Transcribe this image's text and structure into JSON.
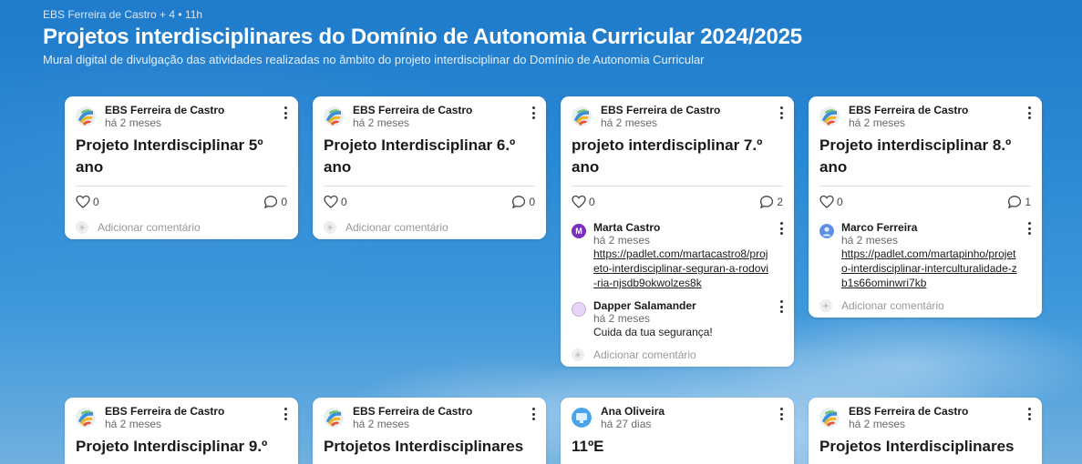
{
  "header": {
    "meta": "EBS Ferreira de Castro + 4 • 11h",
    "title": "Projetos interdisciplinares do Domínio de Autonomia Curricular 2024/2025",
    "subtitle": "Mural digital de divulgação das atividades realizadas no âmbito do projeto interdisciplinar do Domínio de Autonomia Curricular"
  },
  "add_comment_label": "Adicionar comentário",
  "cards": [
    {
      "author": "EBS Ferreira de Castro",
      "time": "há 2 meses",
      "title": "Projeto Interdisciplinar 5º ano",
      "likes": "0",
      "comments": "0"
    },
    {
      "author": "EBS Ferreira de Castro",
      "time": "há 2 meses",
      "title": "Projeto Interdisciplinar 6.º ano",
      "likes": "0",
      "comments": "0"
    },
    {
      "author": "EBS Ferreira de Castro",
      "time": "há 2 meses",
      "title": "projeto interdisciplinar 7.º ano",
      "likes": "0",
      "comments": "2",
      "comment_list": [
        {
          "author": "Marta Castro",
          "time": "há 2 meses",
          "text": "https://padlet.com/martacastro8/projeto-interdisciplinar-seguran-a-rodovi-ria-njsdb9okwolzes8k",
          "is_link": true
        },
        {
          "author": "Dapper Salamander",
          "time": "há 2 meses",
          "text": "Cuida da tua segurança!",
          "is_link": false
        }
      ]
    },
    {
      "author": "EBS Ferreira de Castro",
      "time": "há 2 meses",
      "title": "Projeto interdisciplinar 8.º ano",
      "likes": "0",
      "comments": "1",
      "comment_list": [
        {
          "author": "Marco Ferreira",
          "time": "há 2 meses",
          "text": "https://padlet.com/martapinho/projeto-interdisciplinar-interculturalidade-zb1s66ominwri7kb",
          "is_link": true
        }
      ]
    },
    {
      "author": "EBS Ferreira de Castro",
      "time": "há 2 meses",
      "title": "Projeto Interdisciplinar 9.º"
    },
    {
      "author": "EBS Ferreira de Castro",
      "time": "há 2 meses",
      "title": "Prtojetos Interdisciplinares"
    },
    {
      "author": "Ana Oliveira",
      "time": "há 27 dias",
      "title": "11ºE"
    },
    {
      "author": "EBS Ferreira de Castro",
      "time": "há 2 meses",
      "title": "Projetos Interdisciplinares"
    }
  ],
  "colors": {
    "background": "#2a89d4",
    "card": "#ffffff",
    "marta_avatar": "#7b2fbf",
    "dapper_avatar": "#d9c2f0",
    "marco_avatar": "#5b8ee6",
    "ana_avatar": "#4aa3e8"
  }
}
